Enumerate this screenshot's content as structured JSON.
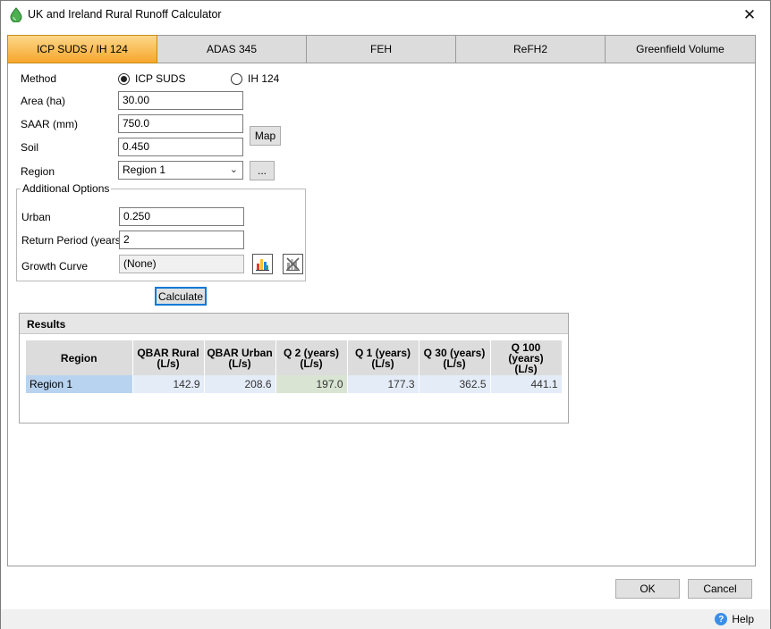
{
  "window": {
    "title": "UK and Ireland Rural Runoff Calculator"
  },
  "tabs": [
    {
      "label": "ICP SUDS / IH 124",
      "active": true
    },
    {
      "label": "ADAS 345",
      "active": false
    },
    {
      "label": "FEH",
      "active": false
    },
    {
      "label": "ReFH2",
      "active": false
    },
    {
      "label": "Greenfield Volume",
      "active": false
    }
  ],
  "form": {
    "method_label": "Method",
    "method_options": [
      {
        "label": "ICP SUDS",
        "selected": true
      },
      {
        "label": "IH 124",
        "selected": false
      }
    ],
    "area_label": "Area (ha)",
    "area_value": "30.00",
    "saar_label": "SAAR (mm)",
    "saar_value": "750.0",
    "map_button": "Map",
    "soil_label": "Soil",
    "soil_value": "0.450",
    "region_label": "Region",
    "region_value": "Region 1",
    "region_more_button": "...",
    "additional_options_title": "Additional Options",
    "urban_label": "Urban",
    "urban_value": "0.250",
    "return_period_label": "Return Period (years)",
    "return_period_value": "2",
    "growth_curve_label": "Growth Curve",
    "growth_curve_value": "(None)",
    "calculate_button": "Calculate"
  },
  "results": {
    "title": "Results",
    "columns": [
      {
        "line1": "Region",
        "line2": ""
      },
      {
        "line1": "QBAR Rural",
        "line2": "(L/s)"
      },
      {
        "line1": "QBAR Urban",
        "line2": "(L/s)"
      },
      {
        "line1": "Q 2 (years)",
        "line2": "(L/s)"
      },
      {
        "line1": "Q 1 (years)",
        "line2": "(L/s)"
      },
      {
        "line1": "Q 30 (years)",
        "line2": "(L/s)"
      },
      {
        "line1": "Q 100 (years)",
        "line2": "(L/s)"
      }
    ],
    "rows": [
      [
        "Region 1",
        "142.9",
        "208.6",
        "197.0",
        "177.3",
        "362.5",
        "441.1"
      ]
    ]
  },
  "footer": {
    "ok_button": "OK",
    "cancel_button": "Cancel",
    "help_label": "Help"
  },
  "colors": {
    "active_tab": "#f6a72c",
    "selected_cell": "#b8d3f0",
    "highlight_cell": "#d9e4d2",
    "app_icon": "#4caf50"
  }
}
